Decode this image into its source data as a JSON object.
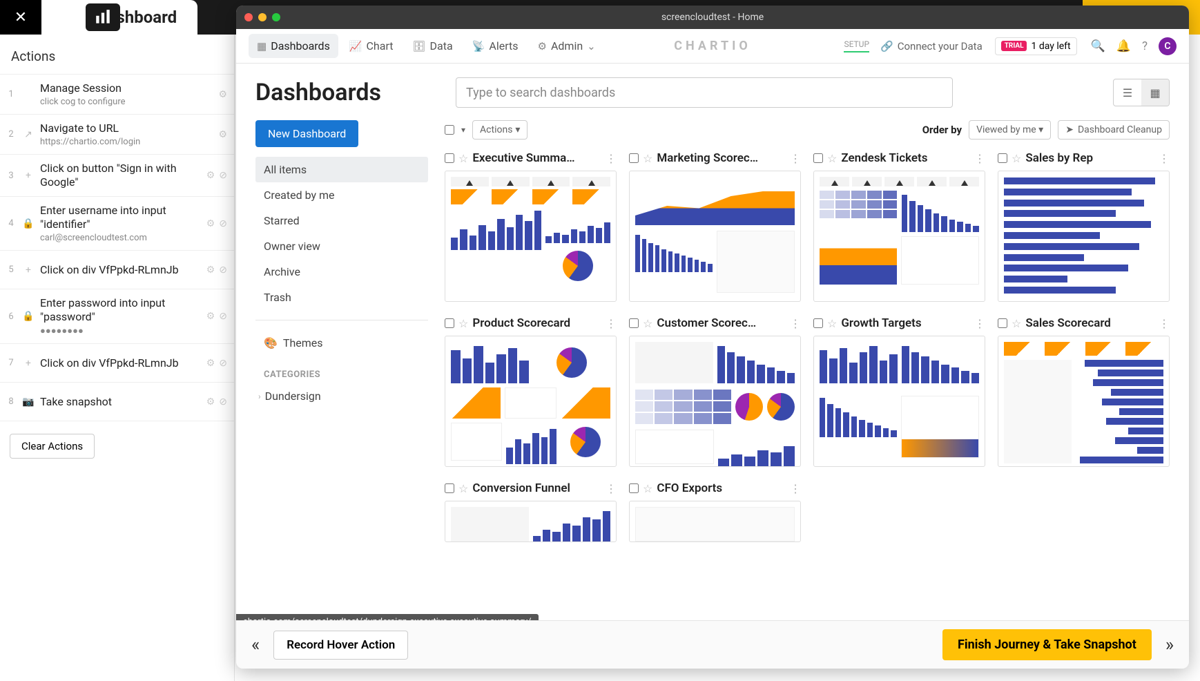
{
  "host": {
    "title": "Dashboard",
    "actions_header": "Actions",
    "clear_actions": "Clear Actions",
    "steps": [
      {
        "n": "1",
        "title": "Manage Session",
        "sub": "click cog to configure",
        "icon": ""
      },
      {
        "n": "2",
        "title": "Navigate to URL",
        "sub": "https://chartio.com/login",
        "icon": "↗"
      },
      {
        "n": "3",
        "title": "Click on button \"Sign in with Google\"",
        "sub": "",
        "icon": "+"
      },
      {
        "n": "4",
        "title": "Enter username into input \"identifier\"",
        "sub": "carl@screencloudtest.com",
        "icon": "🔒"
      },
      {
        "n": "5",
        "title": "Click on div VfPpkd-RLmnJb",
        "sub": "",
        "icon": "+"
      },
      {
        "n": "6",
        "title": "Enter password into input \"password\"",
        "sub": "●●●●●●●●",
        "icon": "🔒"
      },
      {
        "n": "7",
        "title": "Click on div VfPpkd-RLmnJb",
        "sub": "",
        "icon": "+"
      },
      {
        "n": "8",
        "title": "Take snapshot",
        "sub": "",
        "icon": "📷"
      }
    ]
  },
  "window": {
    "title": "screencloudtest - Home"
  },
  "nav": {
    "items": [
      "Dashboards",
      "Chart",
      "Data",
      "Alerts",
      "Admin"
    ],
    "brand": "CHARTIO",
    "setup": "SETUP",
    "connect": "Connect your Data",
    "trial_pill": "TRIAL",
    "trial_text": "1 day left",
    "avatar": "C"
  },
  "page": {
    "heading": "Dashboards",
    "search_placeholder": "Type to search dashboards",
    "new_dashboard": "New Dashboard",
    "filters": [
      "All items",
      "Created by me",
      "Starred",
      "Owner view",
      "Archive",
      "Trash"
    ],
    "themes": "Themes",
    "categories_header": "CATEGORIES",
    "categories": [
      "Dundersign"
    ],
    "toolbar": {
      "actions": "Actions",
      "order_by": "Order by",
      "order_value": "Viewed by me",
      "cleanup": "Dashboard Cleanup"
    },
    "dashboards": [
      "Executive Summa…",
      "Marketing Scorec…",
      "Zendesk Tickets",
      "Sales by Rep",
      "Product Scorecard",
      "Customer Scorec…",
      "Growth Targets",
      "Sales Scorecard",
      "Conversion Funnel",
      "CFO Exports"
    ]
  },
  "bottom": {
    "record": "Record Hover Action",
    "finish": "Finish Journey & Take Snapshot",
    "url_hint": "chartio.com/screencloudtest/dundersign-executive-executive-summary/"
  }
}
